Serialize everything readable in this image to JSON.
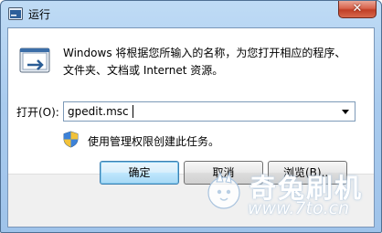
{
  "window": {
    "title": "运行",
    "close_symbol": "✕",
    "title_icon": "run-dialog-icon"
  },
  "dialog": {
    "description_line1": "Windows 将根据您所输入的名称，为您打开相应的程序、",
    "description_line2": "文件夹、文档或 Internet 资源。",
    "open_label": "打开(O):",
    "command_value": "gpedit.msc",
    "admin_note": "使用管理权限创建此任务。",
    "admin_icon": "uac-shield-icon"
  },
  "buttons": {
    "ok": "确定",
    "cancel": "取消",
    "browse": "浏览(B)..."
  },
  "watermark": {
    "title": "奇兔刷机",
    "url": "www.7to.cn"
  },
  "colors": {
    "title_bar": "#a9cbee",
    "close_button": "#c13f26",
    "footer": "#f0f0f0"
  }
}
